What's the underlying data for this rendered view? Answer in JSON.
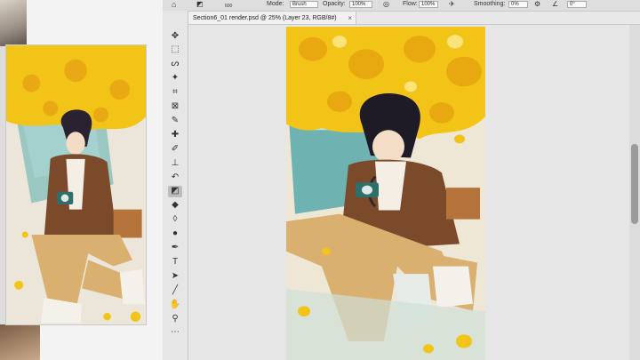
{
  "document": {
    "tab_title": "Section6_01 render.psd @ 25% (Layer 23, RGB/8#)",
    "close_symbol": "×"
  },
  "options_bar": {
    "brush_size": "600",
    "mode_label": "Mode:",
    "mode_value": "Brush",
    "opacity_label": "Opacity:",
    "opacity_value": "100%",
    "flow_label": "Flow:",
    "flow_value": "100%",
    "smoothing_label": "Smoothing:",
    "smoothing_value": "0%",
    "angle_value": "0°"
  },
  "toolbar": {
    "tools": [
      {
        "name": "move-tool",
        "glyph": "✥"
      },
      {
        "name": "marquee-tool",
        "glyph": "⬚"
      },
      {
        "name": "lasso-tool",
        "glyph": "ᔕ"
      },
      {
        "name": "magic-wand-tool",
        "glyph": "✦"
      },
      {
        "name": "crop-tool",
        "glyph": "⌗"
      },
      {
        "name": "frame-tool",
        "glyph": "⊠"
      },
      {
        "name": "eyedropper-tool",
        "glyph": "✎"
      },
      {
        "name": "spot-healing-tool",
        "glyph": "✚"
      },
      {
        "name": "brush-tool",
        "glyph": "✐"
      },
      {
        "name": "clone-stamp-tool",
        "glyph": "⊥"
      },
      {
        "name": "history-brush-tool",
        "glyph": "↶"
      },
      {
        "name": "eraser-tool",
        "glyph": "◩",
        "active": true
      },
      {
        "name": "paint-bucket-tool",
        "glyph": "◆"
      },
      {
        "name": "blur-tool",
        "glyph": "◊"
      },
      {
        "name": "dodge-tool",
        "glyph": "●"
      },
      {
        "name": "pen-tool",
        "glyph": "✒"
      },
      {
        "name": "type-tool",
        "glyph": "T"
      },
      {
        "name": "path-selection-tool",
        "glyph": "➤"
      },
      {
        "name": "line-tool",
        "glyph": "╱"
      },
      {
        "name": "hand-tool",
        "glyph": "✋"
      },
      {
        "name": "zoom-tool",
        "glyph": "⚲"
      },
      {
        "name": "more-tools",
        "glyph": "⋯"
      }
    ]
  },
  "colors": {
    "chrome": "#e8e8e8",
    "ginkgo_yellow": "#f2c418",
    "jacket_brown": "#7a4a2b",
    "pants_khaki": "#d9b070",
    "window_teal": "#7fbcb9"
  }
}
